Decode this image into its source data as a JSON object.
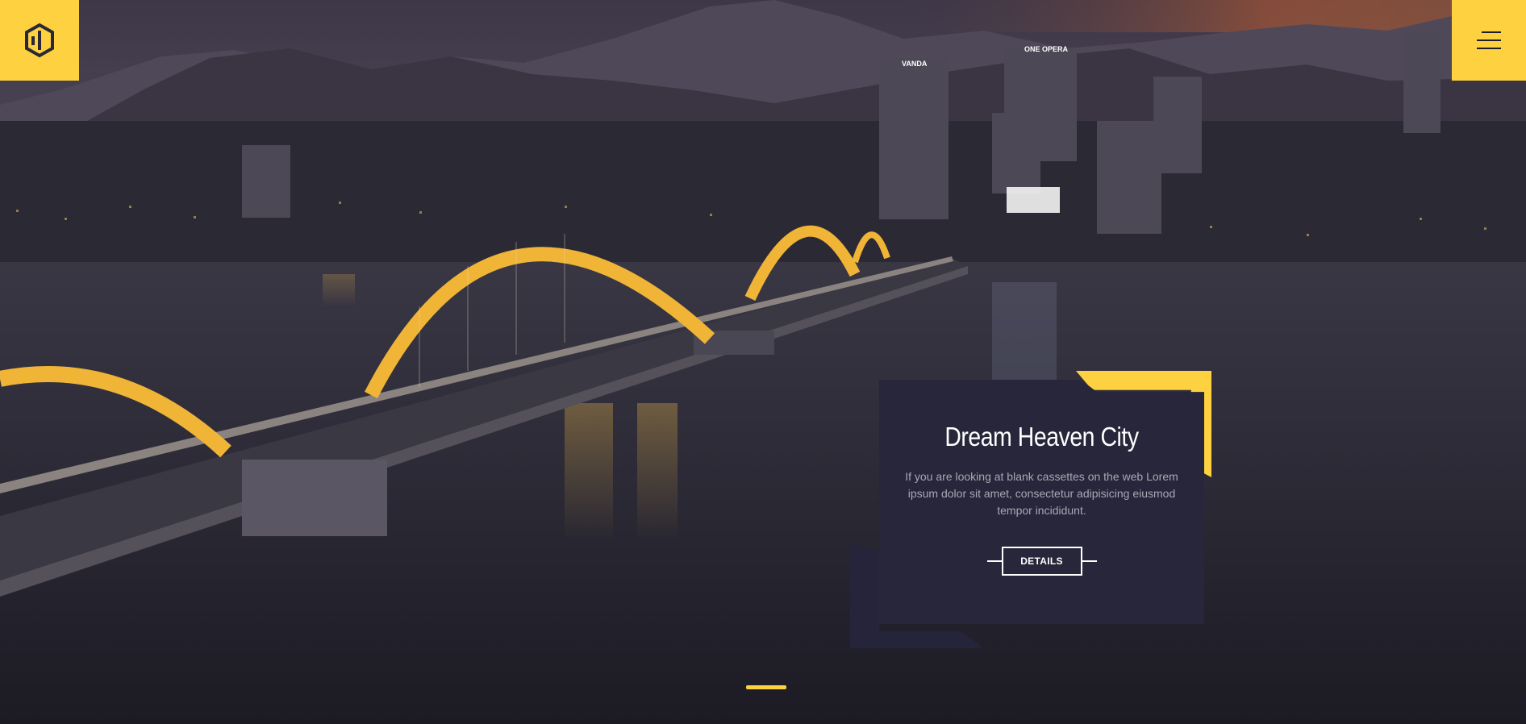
{
  "header": {
    "logo_icon": "hexagon-logo-icon",
    "menu_icon": "hamburger-menu-icon"
  },
  "colors": {
    "accent": "#fdd13f",
    "card_bg": "#27263a",
    "card_text": "#a9a8b4",
    "title": "#ffffff"
  },
  "hero": {
    "sign_vanda": "VANDA",
    "sign_hotel": "ONE OPERA"
  },
  "card": {
    "title": "Dream Heaven City",
    "text": "If you are looking at blank cassettes on the web Lorem ipsum dolor sit amet, consectetur adipisicing eiusmod tempor incididunt.",
    "button": "DETAILS"
  },
  "slider": {
    "active_index": 1,
    "count": 1
  }
}
